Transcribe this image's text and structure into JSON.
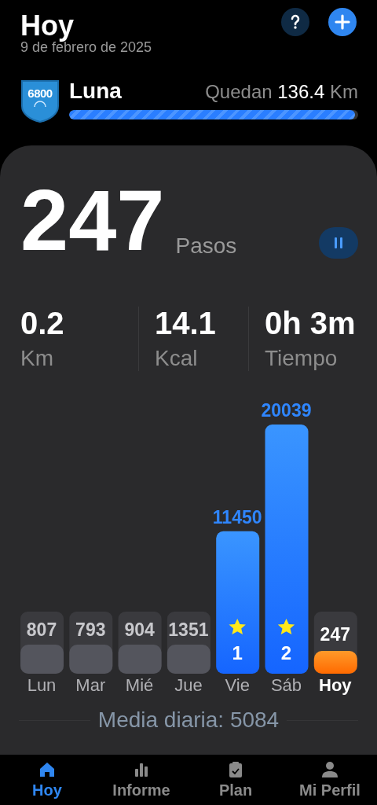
{
  "header": {
    "title": "Hoy",
    "date": "9 de febrero de 2025"
  },
  "challenge": {
    "badge": "6800",
    "name": "Luna",
    "remaining_label": "Quedan",
    "remaining_value": "136.4",
    "remaining_unit": "Km",
    "level": 0.99
  },
  "steps": {
    "value": "247",
    "unit": "Pasos",
    "paused": false
  },
  "stats": [
    {
      "value": "0.2",
      "label": "Km"
    },
    {
      "value": "14.1",
      "label": "Kcal"
    },
    {
      "value": "0h 3m",
      "label": "Tiempo"
    }
  ],
  "days": [
    {
      "label": "Lun",
      "steps": "807",
      "kind": "low"
    },
    {
      "label": "Mar",
      "steps": "793",
      "kind": "low"
    },
    {
      "label": "Mié",
      "steps": "904",
      "kind": "low"
    },
    {
      "label": "Jue",
      "steps": "1351",
      "kind": "low"
    },
    {
      "label": "Vie",
      "steps": "11450",
      "kind": "goal",
      "medal": "1"
    },
    {
      "label": "Sáb",
      "steps": "20039",
      "kind": "goal",
      "medal": "2"
    },
    {
      "label": "Hoy",
      "steps": "247",
      "kind": "today"
    }
  ],
  "average": "Media diaria: 5084",
  "nav": [
    {
      "label": "Hoy",
      "selected": true
    },
    {
      "label": "Informe",
      "selected": false
    },
    {
      "label": "Plan",
      "selected": false
    },
    {
      "label": "Mi Perfil",
      "selected": false
    }
  ]
}
